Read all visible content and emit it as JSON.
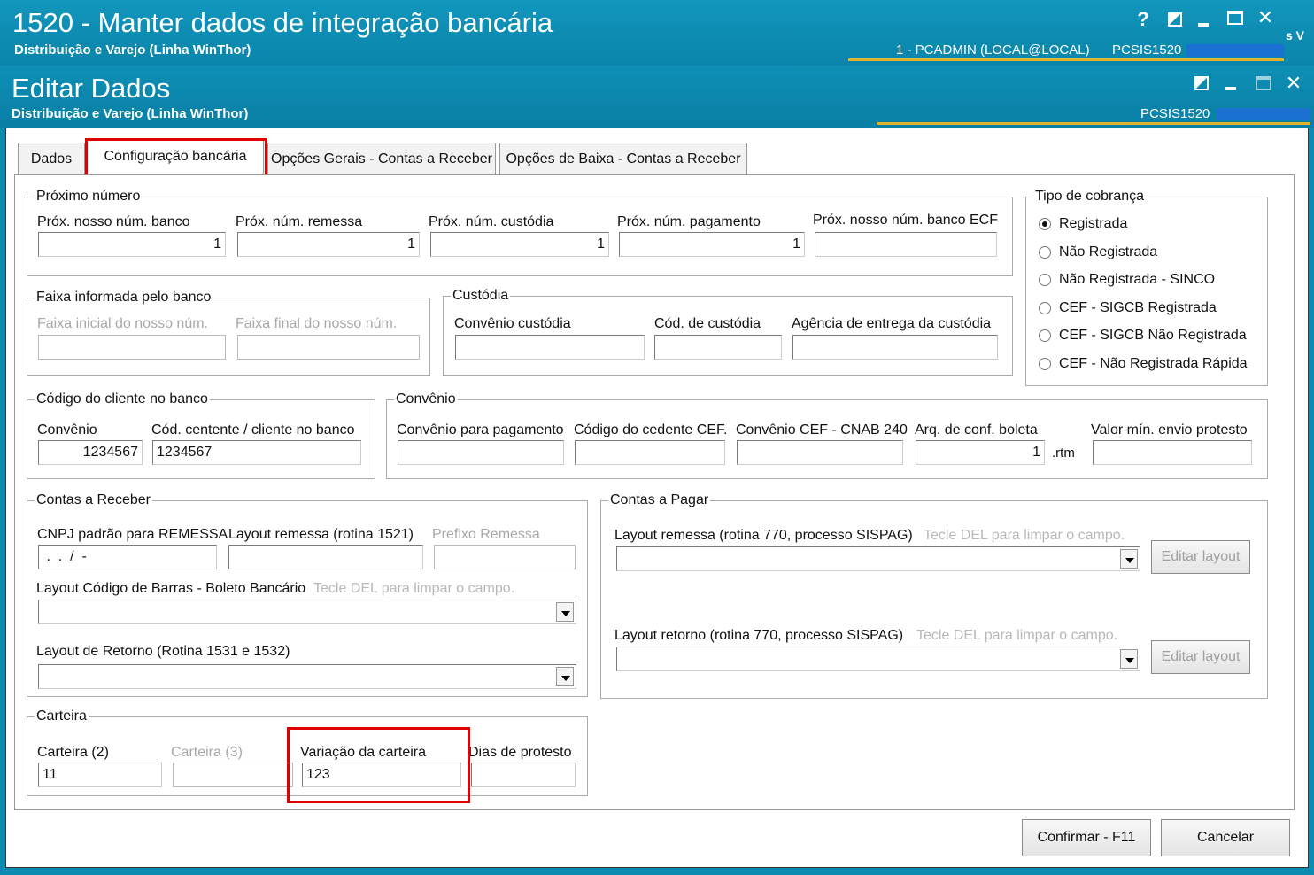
{
  "outer_window": {
    "title": "1520 - Manter dados de integração bancária",
    "subtitle": "Distribuição e Varejo (Linha WinThor)",
    "user": "1 - PCADMIN (LOCAL@LOCAL)",
    "program": "PCSIS1520",
    "help_label": "?",
    "close_label": "✕",
    "edge_text": "s V"
  },
  "dialog": {
    "title": "Editar Dados",
    "subtitle": "Distribuição e Varejo (Linha WinThor)",
    "program": "PCSIS1520",
    "close_label": "✕"
  },
  "tabs": [
    {
      "label": "Dados"
    },
    {
      "label": "Configuração bancária"
    },
    {
      "label": "Opções Gerais - Contas a Receber"
    },
    {
      "label": "Opções de Baixa - Contas a Receber"
    }
  ],
  "proximo": {
    "title": "Próximo número",
    "fields": [
      {
        "label": "Próx. nosso núm. banco",
        "value": "1"
      },
      {
        "label": "Próx. núm. remessa",
        "value": "1"
      },
      {
        "label": "Próx. núm. custódia",
        "value": "1"
      },
      {
        "label": "Próx. núm. pagamento",
        "value": "1"
      },
      {
        "label": "Próx. nosso núm. banco ECF",
        "value": ""
      }
    ]
  },
  "tipo_cobranca": {
    "title": "Tipo de cobrança",
    "options": [
      {
        "label": "Registrada",
        "selected": true
      },
      {
        "label": "Não Registrada",
        "selected": false
      },
      {
        "label": "Não Registrada - SINCO",
        "selected": false
      },
      {
        "label": "CEF - SIGCB Registrada",
        "selected": false
      },
      {
        "label": "CEF - SIGCB Não Registrada",
        "selected": false
      },
      {
        "label": "CEF - Não Registrada Rápida",
        "selected": false
      }
    ]
  },
  "faixa": {
    "title": "Faixa informada pelo banco",
    "inicial_label": "Faixa inicial do nosso núm.",
    "final_label": "Faixa final do nosso núm."
  },
  "custodia": {
    "title": "Custódia",
    "convenio_label": "Convênio custódia",
    "cod_label": "Cód. de custódia",
    "agencia_label": "Agência de entrega da custódia"
  },
  "codigo_cliente": {
    "title": "Código do cliente no banco",
    "convenio_label": "Convênio",
    "convenio_value": "1234567",
    "cedente_label": "Cód. centente / cliente no banco",
    "cedente_value": "1234567"
  },
  "convenio": {
    "title": "Convênio",
    "pagamento_label": "Convênio para pagamento",
    "cedente_cef_label": "Código do cedente CEF.",
    "cnab_label": "Convênio CEF - CNAB 240",
    "arq_label": "Arq. de conf. boleta",
    "arq_value": "1",
    "arq_ext": ".rtm",
    "protesto_label": "Valor mín. envio protesto"
  },
  "contas_receber": {
    "title": "Contas a Receber",
    "cnpj_label": "CNPJ padrão para REMESSA",
    "cnpj_value": " .  .  /  -",
    "layout_remessa_label": "Layout remessa (rotina 1521)",
    "prefixo_label": "Prefixo Remessa",
    "barras_label": "Layout Código de Barras - Boleto Bancário",
    "barras_hint": "Tecle DEL para limpar o campo.",
    "retorno_label": "Layout  de Retorno (Rotina 1531 e 1532)"
  },
  "contas_pagar": {
    "title": "Contas a Pagar",
    "remessa_label": "Layout remessa (rotina 770, processo SISPAG)",
    "remessa_hint": "Tecle DEL para limpar o campo.",
    "retorno_label": "Layout retorno (rotina 770, processo SISPAG)",
    "retorno_hint": "Tecle DEL para limpar o campo.",
    "edit_layout_label": "Editar layout"
  },
  "carteira": {
    "title": "Carteira",
    "c2_label": "Carteira (2)",
    "c2_value": "11",
    "c3_label": "Carteira (3)",
    "variacao_label": "Variação da carteira",
    "variacao_value": "123",
    "dias_label": "Dias de protesto"
  },
  "buttons": {
    "confirm": "Confirmar - F11",
    "cancel": "Cancelar"
  }
}
